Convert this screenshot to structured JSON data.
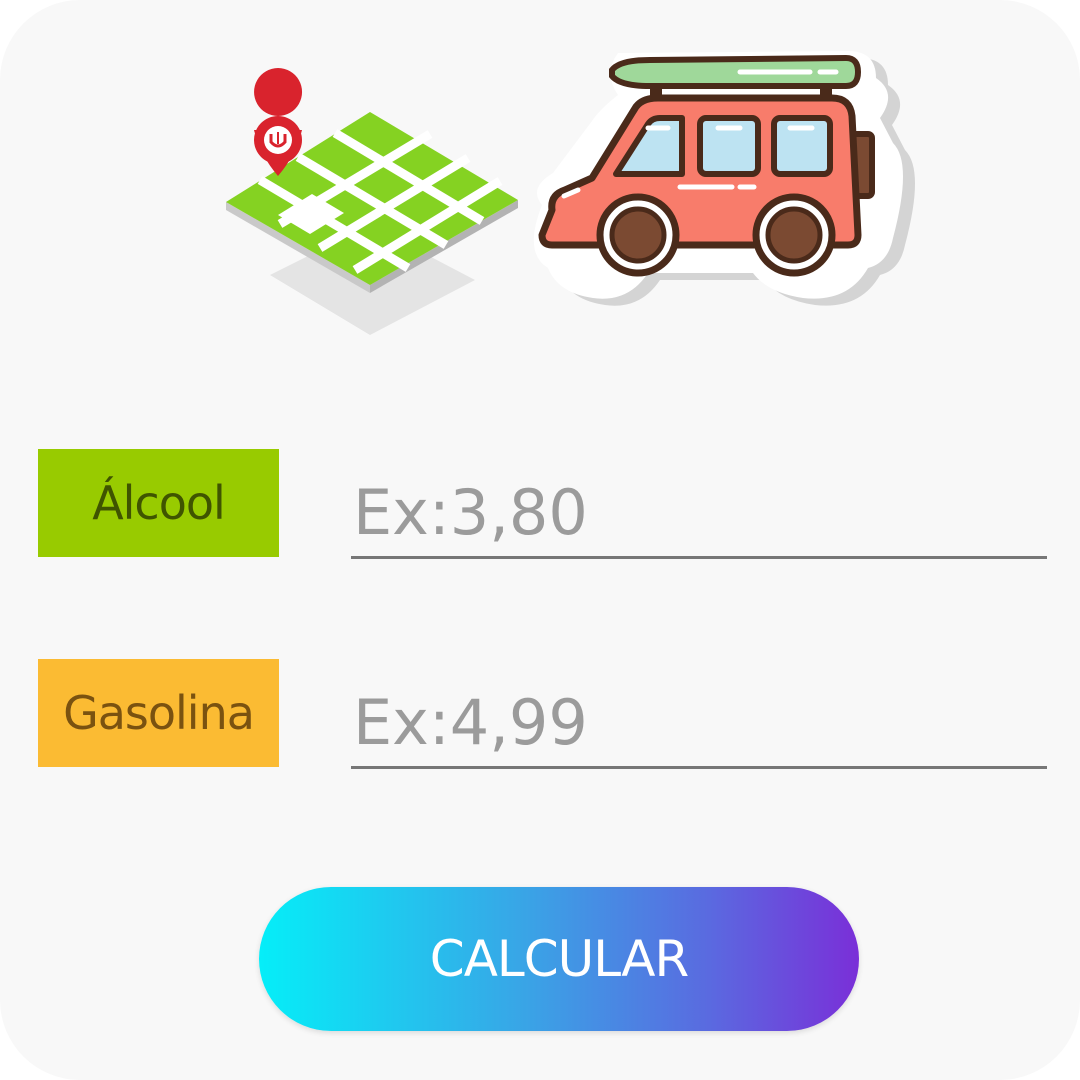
{
  "fields": [
    {
      "label": "Álcool",
      "placeholder": "Ex:3,80",
      "value": ""
    },
    {
      "label": "Gasolina",
      "placeholder": "Ex:4,99",
      "value": ""
    }
  ],
  "action": {
    "calculate_label": "CALCULAR"
  },
  "icons": {
    "map": "map-icon",
    "pin": "location-pin-icon",
    "van": "van-icon"
  },
  "colors": {
    "alcool_label_bg": "#98cb00",
    "alcool_label_text": "#3f5400",
    "gasolina_label_bg": "#fbbb33",
    "gasolina_label_text": "#7a5210",
    "button_gradient_start": "#05eef8",
    "button_gradient_end": "#7a2fd8"
  }
}
